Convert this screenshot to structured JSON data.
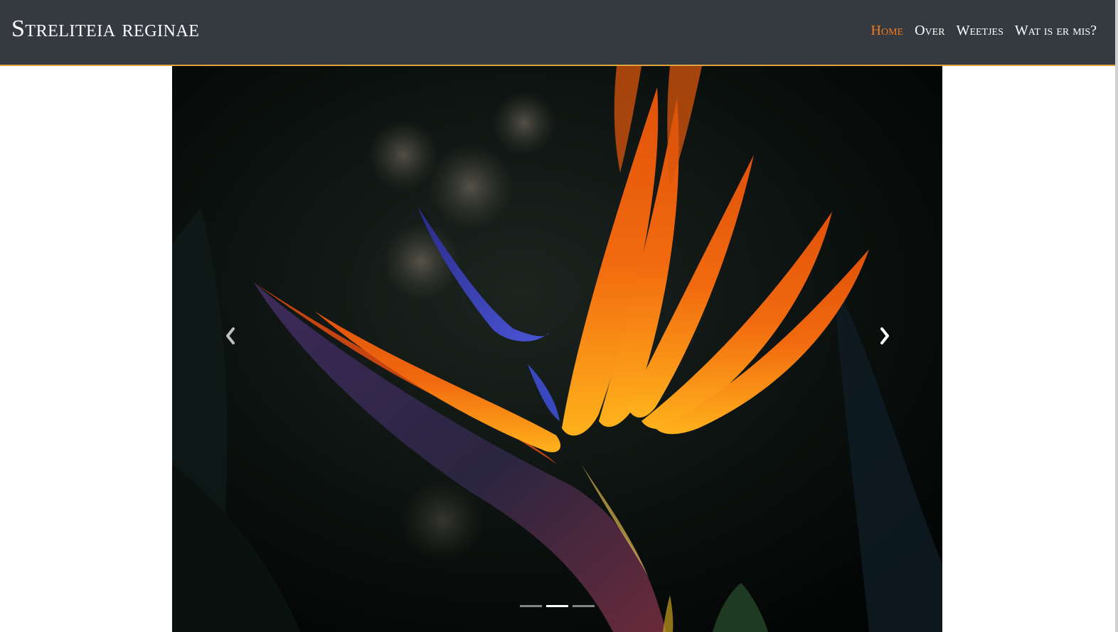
{
  "navbar": {
    "brand": "Streliteia reginae",
    "links": [
      {
        "label": "Home",
        "active": true
      },
      {
        "label": "Over",
        "active": false
      },
      {
        "label": "Weetjes",
        "active": false
      },
      {
        "label": "Wat is er mis?",
        "active": false
      }
    ]
  },
  "carousel": {
    "slide_description_icon": "bird-of-paradise-flower-photo",
    "prev_icon": "chevron-left-icon",
    "next_icon": "chevron-right-icon",
    "indicator_count": 3,
    "active_index": 1
  },
  "colors": {
    "navbar_bg": "#343a40",
    "navbar_border": "#e0a23a",
    "active_link": "#f07a1e",
    "link": "#ffffff"
  }
}
